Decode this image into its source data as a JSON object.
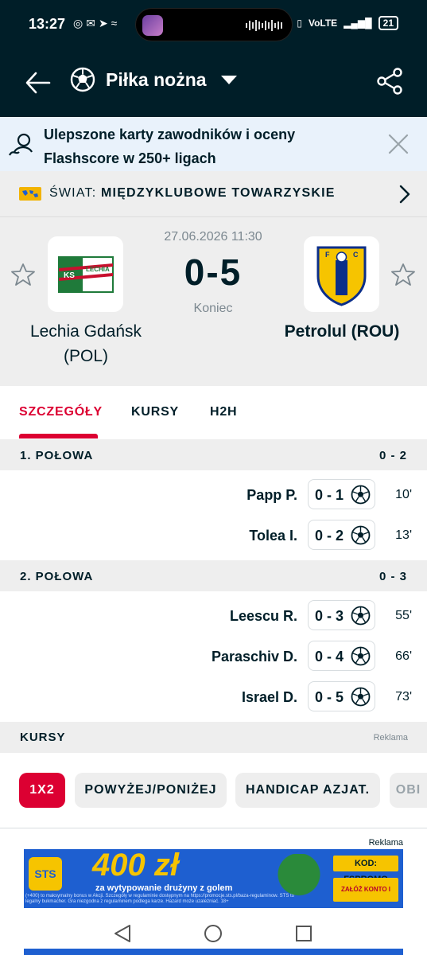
{
  "status_bar": {
    "time": "13:27",
    "left_icons": "◎✉➤≈",
    "network": "VoLTE",
    "battery": "21"
  },
  "header": {
    "title": "Piłka nożna"
  },
  "promo": {
    "text": "Ulepszone karty zawodników i oceny Flashscore w 250+ ligach"
  },
  "league": {
    "country": "ŚWIAT:",
    "name": "MIĘDZYKLUBOWE TOWARZYSKIE"
  },
  "match": {
    "datetime": "27.06.2026 11:30",
    "score": "0-5",
    "status": "Koniec",
    "home": {
      "name": "Lechia Gdańsk (POL)",
      "logo_text": "KS LECHIA",
      "color": "#1f7a3a"
    },
    "away": {
      "name": "Petrolul (ROU)",
      "logo_text": "FC PETROLUL",
      "color": "#f6c400"
    }
  },
  "tabs": [
    {
      "label": "SZCZEGÓŁY",
      "active": true
    },
    {
      "label": "KURSY",
      "active": false
    },
    {
      "label": "H2H",
      "active": false
    }
  ],
  "halves": [
    {
      "title": "1. POŁOWA",
      "score": "0 - 2",
      "events": [
        {
          "player": "Papp P.",
          "score": "0 - 1",
          "minute": "10'"
        },
        {
          "player": "Tolea I.",
          "score": "0 - 2",
          "minute": "13'"
        }
      ]
    },
    {
      "title": "2. POŁOWA",
      "score": "0 - 3",
      "events": [
        {
          "player": "Leescu R.",
          "score": "0 - 3",
          "minute": "55'"
        },
        {
          "player": "Paraschiv D.",
          "score": "0 - 4",
          "minute": "66'"
        },
        {
          "player": "Israel D.",
          "score": "0 - 5",
          "minute": "73'"
        }
      ]
    }
  ],
  "odds": {
    "title": "KURSY",
    "ad_label": "Reklama",
    "chips": [
      {
        "label": "1X2",
        "active": true
      },
      {
        "label": "POWYŻEJ/PONIŻEJ",
        "active": false
      },
      {
        "label": "HANDICAP AZJAT.",
        "active": false
      },
      {
        "label": "OBI",
        "active": false
      }
    ]
  },
  "ad": {
    "label": "Reklama",
    "brand": "STS",
    "amount": "400 zł",
    "subtitle": "za wytypowanie drużyny z golem",
    "code": "KOD: FSPROMO",
    "cta": "ZAŁÓŻ KONTO I OBSTAW",
    "fine_print": "(+400) to maksymalny bonus w Akcji. Szczegóły w regulaminie dostępnym na https://promocje.sts.pl/baza-regulaminow. STS to legalny bukmacher. Gra niezgodna z regulaminem podlega karze. Hazard może uzależniać. 18+"
  },
  "colors": {
    "dark": "#001e28",
    "accent": "#dc0032",
    "surface": "#eeeeee"
  }
}
